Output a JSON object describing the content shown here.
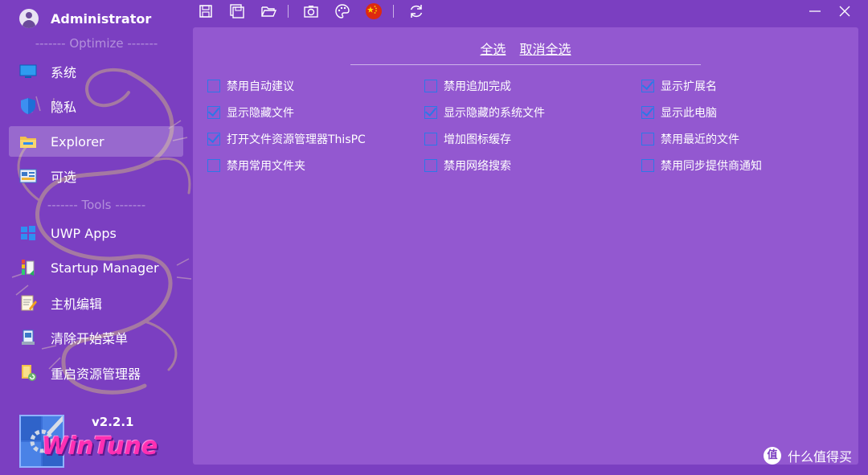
{
  "user": {
    "name": "Administrator"
  },
  "sidebar": {
    "section_optimize": "------- Optimize -------",
    "section_tools": "------- Tools -------",
    "items": [
      {
        "label": "系统",
        "icon": "monitor-icon"
      },
      {
        "label": "隐私",
        "icon": "shield-icon"
      },
      {
        "label": "Explorer",
        "icon": "folder-icon",
        "active": true
      },
      {
        "label": "可选",
        "icon": "settings-panel-icon"
      },
      {
        "label": "UWP Apps",
        "icon": "windows-icon"
      },
      {
        "label": "Startup Manager",
        "icon": "startup-icon"
      },
      {
        "label": "主机编辑",
        "icon": "edit-document-icon"
      },
      {
        "label": "清除开始菜单",
        "icon": "cleanup-icon"
      },
      {
        "label": "重启资源管理器",
        "icon": "refresh-folder-icon"
      }
    ],
    "version": "v2.2.1",
    "logo_text": "WinTune"
  },
  "toolbar": {
    "icons": [
      "save-icon",
      "save-all-icon",
      "open-folder-icon",
      "camera-icon",
      "palette-icon",
      "china-flag-icon",
      "refresh-icon"
    ]
  },
  "panel": {
    "select_all": "全选",
    "deselect_all": "取消全选",
    "options": [
      [
        {
          "label": "禁用自动建议",
          "checked": false
        },
        {
          "label": "显示隐藏文件",
          "checked": true
        },
        {
          "label": "打开文件资源管理器ThisPC",
          "checked": true
        },
        {
          "label": "禁用常用文件夹",
          "checked": false
        }
      ],
      [
        {
          "label": "禁用追加完成",
          "checked": false
        },
        {
          "label": "显示隐藏的系统文件",
          "checked": true
        },
        {
          "label": "增加图标缓存",
          "checked": false
        },
        {
          "label": "禁用网络搜索",
          "checked": false
        }
      ],
      [
        {
          "label": "显示扩展名",
          "checked": true
        },
        {
          "label": "显示此电脑",
          "checked": true
        },
        {
          "label": "禁用最近的文件",
          "checked": false
        },
        {
          "label": "禁用同步提供商通知",
          "checked": false
        }
      ]
    ]
  },
  "watermark": {
    "icon_text": "值",
    "text": "什么值得买"
  },
  "colors": {
    "background": "#7b3fc1",
    "panel": "#9358d0",
    "checkbox": "#2b78e8",
    "logo": "#ff2fb2"
  }
}
